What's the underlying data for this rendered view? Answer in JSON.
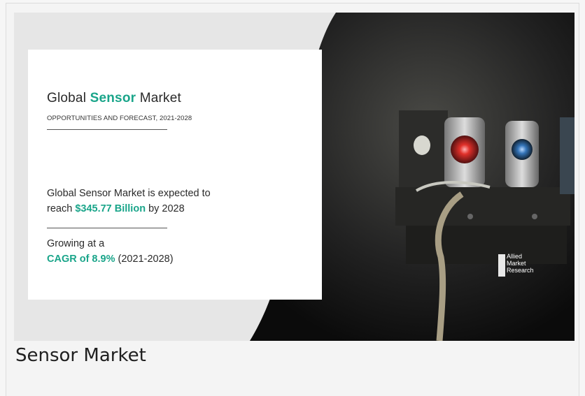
{
  "infographic": {
    "title_prefix": "Global ",
    "title_highlight": "Sensor",
    "title_suffix": " Market",
    "subtitle": "OPPORTUNITIES AND FORECAST, 2021-2028",
    "body_line1": "Global Sensor Market is expected to",
    "body_line2_prefix": "reach ",
    "body_line2_highlight": "$345.77 Billion",
    "body_line2_suffix": " by 2028",
    "growth_line1": "Growing at a",
    "growth_highlight": "CAGR of 8.9%",
    "growth_suffix": "  (2021-2028)",
    "logo_line1": "Allied",
    "logo_line2": "Market",
    "logo_line3": "Research",
    "accent_color": "#1aa58a"
  },
  "caption": "Sensor Market"
}
